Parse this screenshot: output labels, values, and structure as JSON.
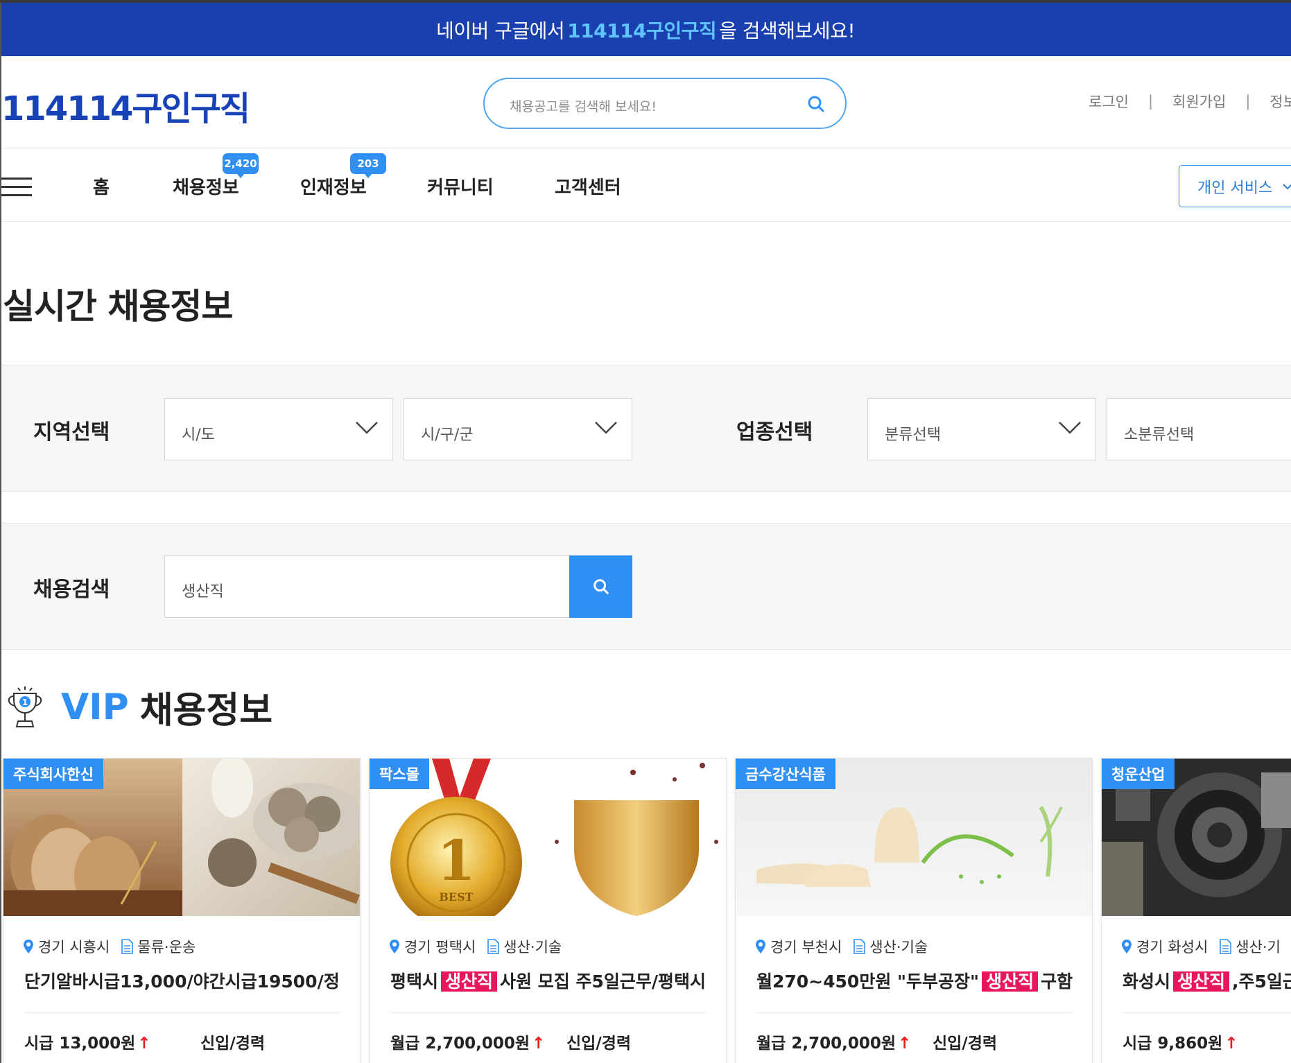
{
  "banner": {
    "prefix": "네이버 구글에서",
    "highlight": "114114구인구직",
    "suffix": "을 검색해보세요!"
  },
  "header": {
    "logo": "114114구인구직",
    "search_placeholder": "채용공고를 검색해 보세요!",
    "links": [
      "로그인",
      "회원가입",
      "정보"
    ]
  },
  "nav": {
    "items": [
      {
        "label": "홈"
      },
      {
        "label": "채용정보",
        "badge": "2,420"
      },
      {
        "label": "인재정보",
        "badge": "203"
      },
      {
        "label": "커뮤니티"
      },
      {
        "label": "고객센터"
      }
    ],
    "personal_service": "개인 서비스"
  },
  "page_title": "실시간 채용정보",
  "filters": {
    "region_label": "지역선택",
    "region_sido": "시/도",
    "region_sigungu": "시/구/군",
    "industry_label": "업종선택",
    "industry_major": "분류선택",
    "industry_minor": "소분류선택"
  },
  "job_search": {
    "label": "채용검색",
    "value": "생산직"
  },
  "vip": {
    "label": "VIP",
    "title": "채용정보"
  },
  "cards": [
    {
      "company": "주식회사한신",
      "location": "경기 시흥시",
      "category": "물류·운송",
      "title_pre": "단기알바시급13,000/야간시급19500/정",
      "keyword": "",
      "title_post": "",
      "pay": "시급 13,000원",
      "experience": "신입/경력"
    },
    {
      "company": "팍스몰",
      "location": "경기 평택시",
      "category": "생산·기술",
      "title_pre": "평택시",
      "keyword": "생산직",
      "title_post": "사원 모집 주5일근무/평택시",
      "pay": "월급 2,700,000원",
      "experience": "신입/경력"
    },
    {
      "company": "금수강산식품",
      "location": "경기 부천시",
      "category": "생산·기술",
      "title_pre": "월270~450만원 \"두부공장\"",
      "keyword": "생산직",
      "title_post": "구함",
      "pay": "월급 2,700,000원",
      "experience": "신입/경력"
    },
    {
      "company": "청운산업",
      "location": "경기 화성시",
      "category": "생산·기",
      "title_pre": "화성시",
      "keyword": "생산직",
      "title_post": ",주5일근",
      "pay": "시급 9,860원",
      "experience": ""
    }
  ],
  "colors": {
    "banner_bg": "#1a3fae",
    "accent": "#2f8ff2",
    "logo": "#1843b8",
    "keyword_bg": "#e8175d",
    "up_arrow": "#e81d1d"
  },
  "icons": [
    "search-icon",
    "hamburger-icon",
    "chevron-down-icon",
    "trophy-icon",
    "location-pin-icon",
    "document-icon",
    "arrow-up-icon"
  ]
}
